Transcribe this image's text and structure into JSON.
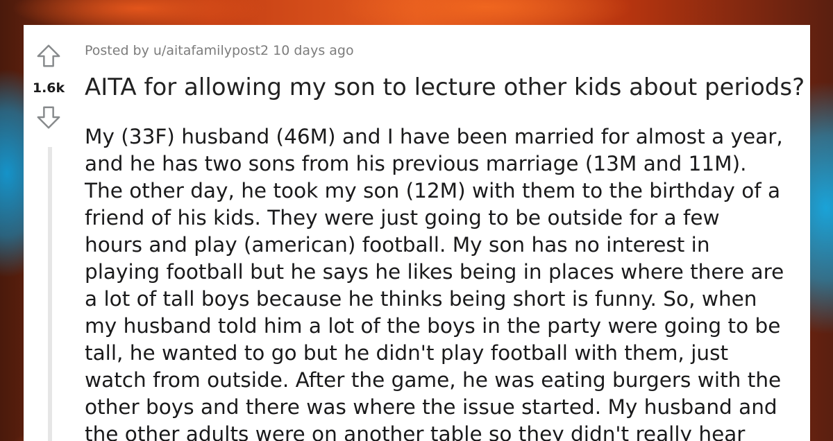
{
  "post": {
    "score": "1.6k",
    "meta": "Posted by u/aitafamilypost2 10 days ago",
    "title": "AITA for allowing my son to lecture other kids about periods?",
    "body_lines": [
      "My (33F) husband (46M) and I have been married for almost a year,",
      "and he has two sons from his previous marriage (13M and 11M).",
      "The other day, he took my son (12M) with them to the birthday of a",
      "friend of his kids. They were just going to be outside for a few",
      "hours and play (american) football. My son has no interest in",
      "playing football but he says he likes being in places where there are",
      "a lot of tall boys because he thinks being short is funny. So, when",
      "my husband told him a lot of the boys in the party were going to be",
      "tall, he wanted to go but he didn't play football with them, just",
      "watch from outside. After the game, he was eating burgers with the",
      "other boys and there was where the issue started. My husband and",
      "the other adults were on another table so they didn't really hear"
    ]
  },
  "icons": {
    "upvote": "upvote-arrow-icon",
    "downvote": "downvote-arrow-icon"
  },
  "colors": {
    "arrow_stroke": "#878a8c",
    "text": "#1a1a1b",
    "meta": "#7c7c7c"
  }
}
